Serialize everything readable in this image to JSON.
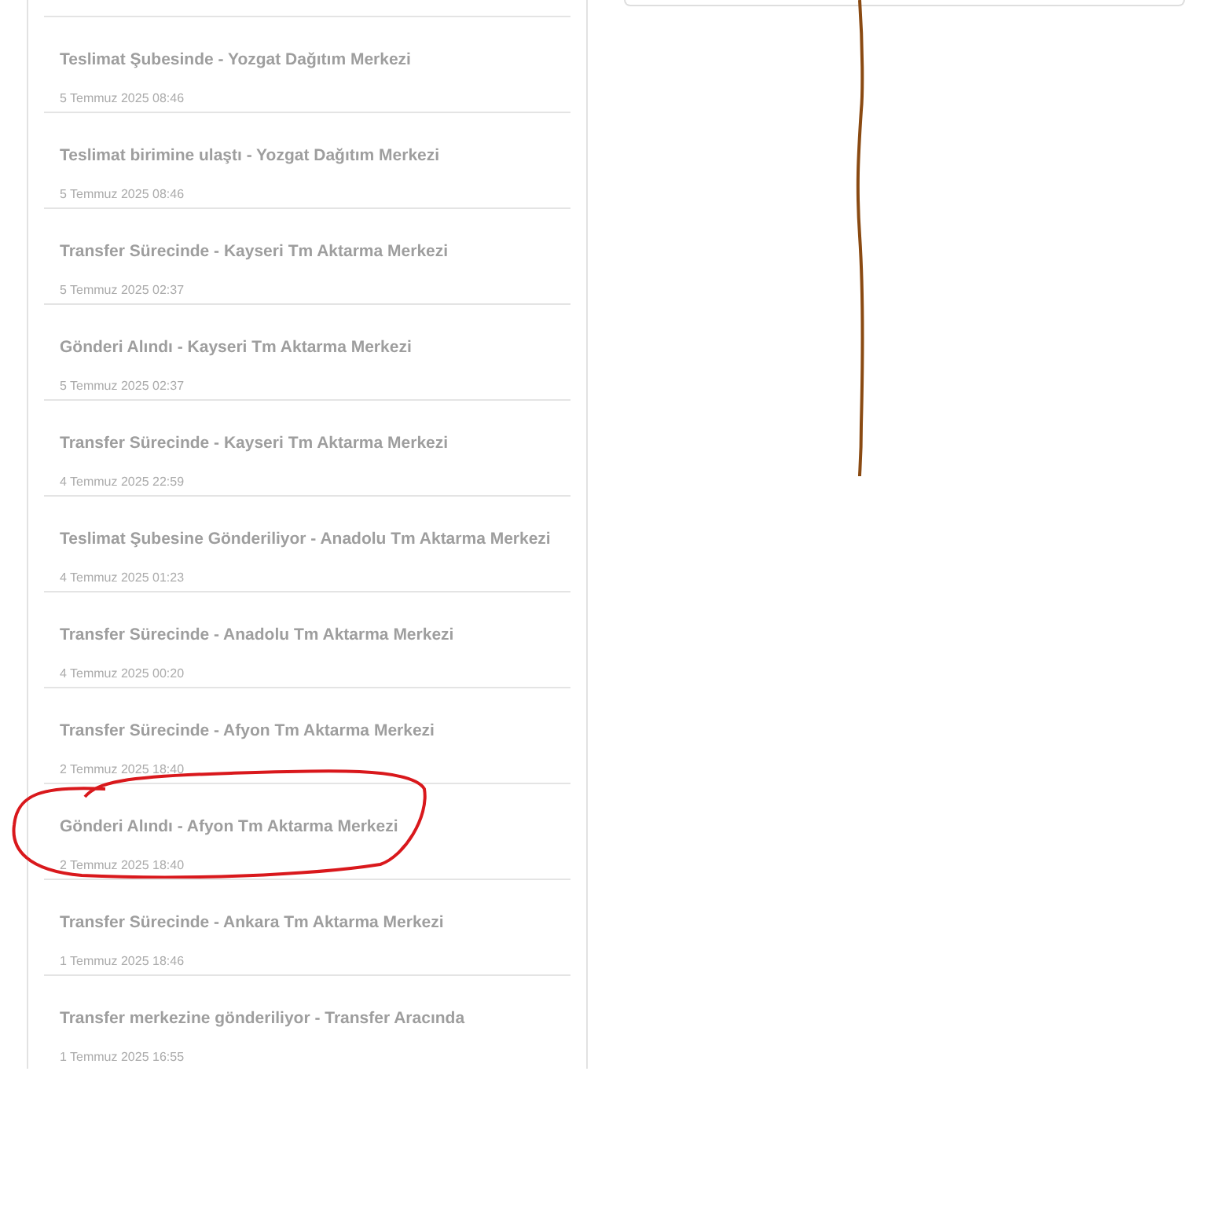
{
  "tracking_events": [
    {
      "title": "Teslimat Şubesinde - Yozgat Dağıtım Merkezi",
      "date": "5 Temmuz 2025 08:46",
      "circled": false
    },
    {
      "title": "Teslimat birimine ulaştı - Yozgat Dağıtım Merkezi",
      "date": "5 Temmuz 2025 08:46",
      "circled": false
    },
    {
      "title": "Transfer Sürecinde - Kayseri Tm Aktarma Merkezi",
      "date": "5 Temmuz 2025 02:37",
      "circled": false
    },
    {
      "title": "Gönderi Alındı - Kayseri Tm Aktarma Merkezi",
      "date": "5 Temmuz 2025 02:37",
      "circled": false
    },
    {
      "title": "Transfer Sürecinde - Kayseri Tm Aktarma Merkezi",
      "date": "4 Temmuz 2025 22:59",
      "circled": false
    },
    {
      "title": "Teslimat Şubesine Gönderiliyor - Anadolu Tm Aktarma Merkezi",
      "date": "4 Temmuz 2025 01:23",
      "circled": false
    },
    {
      "title": "Transfer Sürecinde - Anadolu Tm Aktarma Merkezi",
      "date": "4 Temmuz 2025 00:20",
      "circled": false
    },
    {
      "title": "Transfer Sürecinde - Afyon Tm Aktarma Merkezi",
      "date": "2 Temmuz 2025 18:40",
      "circled": false
    },
    {
      "title": "Gönderi Alındı - Afyon Tm Aktarma Merkezi",
      "date": "2 Temmuz 2025 18:40",
      "circled": true
    },
    {
      "title": "Transfer Sürecinde - Ankara Tm Aktarma Merkezi",
      "date": "1 Temmuz 2025 18:46",
      "circled": false
    },
    {
      "title": "Transfer merkezine gönderiliyor - Transfer Aracında",
      "date": "1 Temmuz 2025 16:55",
      "circled": false
    }
  ],
  "annotations": [
    {
      "kind": "line",
      "color": "#8a4a12"
    }
  ]
}
